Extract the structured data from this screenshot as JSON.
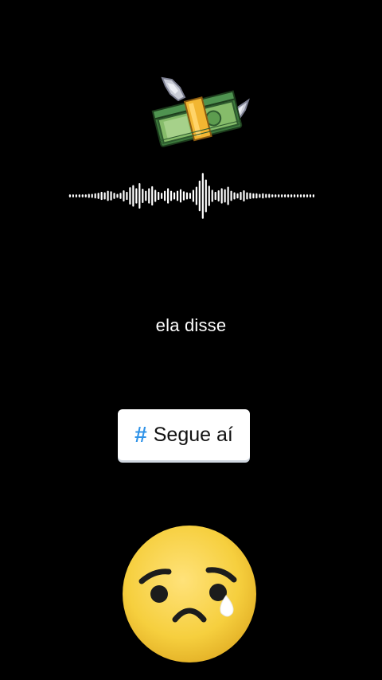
{
  "caption": {
    "text": "ela disse"
  },
  "hashtag_sticker": {
    "symbol": "#",
    "text": "Segue aí",
    "accent_color": "#2f93e8"
  },
  "icons": {
    "top": "flying-money-icon",
    "bottom": "sad-face-tear-icon"
  },
  "audio_waveform": {
    "bar_levels": [
      0.06,
      0.06,
      0.06,
      0.06,
      0.06,
      0.06,
      0.08,
      0.08,
      0.1,
      0.12,
      0.16,
      0.14,
      0.2,
      0.18,
      0.12,
      0.08,
      0.12,
      0.22,
      0.16,
      0.34,
      0.42,
      0.3,
      0.5,
      0.28,
      0.2,
      0.3,
      0.38,
      0.24,
      0.16,
      0.12,
      0.2,
      0.3,
      0.2,
      0.14,
      0.2,
      0.26,
      0.18,
      0.14,
      0.12,
      0.24,
      0.36,
      0.6,
      0.9,
      0.64,
      0.4,
      0.24,
      0.16,
      0.22,
      0.3,
      0.26,
      0.36,
      0.2,
      0.14,
      0.1,
      0.16,
      0.22,
      0.14,
      0.12,
      0.1,
      0.1,
      0.08,
      0.1,
      0.08,
      0.08,
      0.06,
      0.06,
      0.06,
      0.06,
      0.06,
      0.06,
      0.06,
      0.06,
      0.06,
      0.06,
      0.06,
      0.06,
      0.06,
      0.06
    ]
  }
}
